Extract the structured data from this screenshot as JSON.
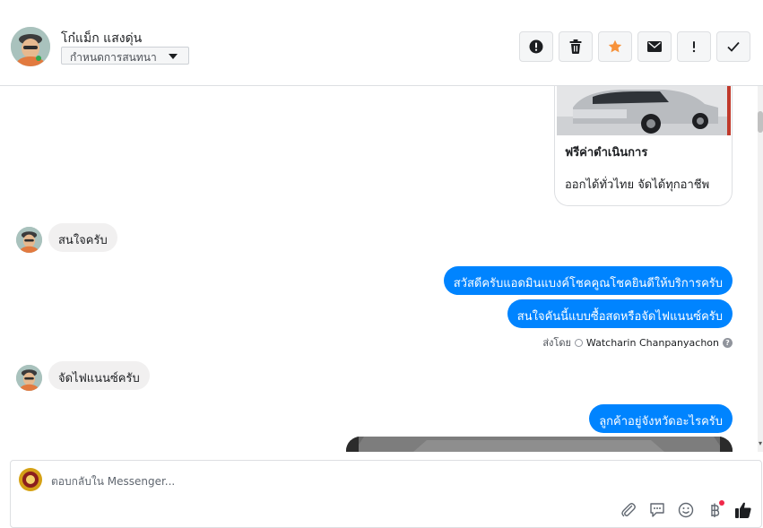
{
  "header": {
    "contact_name": "โก๋แม็ก แสงดุ่น",
    "label_dropdown": "กำหนดการสนทนา",
    "actions": [
      {
        "name": "spam-button",
        "icon": "alert-circle-icon"
      },
      {
        "name": "delete-button",
        "icon": "trash-icon"
      },
      {
        "name": "star-button",
        "icon": "star-icon"
      },
      {
        "name": "mark-unread-button",
        "icon": "envelope-icon"
      },
      {
        "name": "follow-up-button",
        "icon": "exclamation-icon"
      },
      {
        "name": "done-button",
        "icon": "check-icon"
      }
    ]
  },
  "card": {
    "title": "ฟรีค่าดำเนินการ",
    "subtitle": "ออกได้ทั่วไทย จัดได้ทุกอาชีพ"
  },
  "messages": [
    {
      "direction": "in",
      "text": "สนใจครับ"
    },
    {
      "direction": "out",
      "text": "สวัสดีครับแอดมินแบงค์โชคคูณโชคยินดีให้บริการครับ"
    },
    {
      "direction": "out",
      "text": "สนใจคันนี้แบบซื้อสดหรือจัดไฟแนนซ์ครับ"
    },
    {
      "direction": "in",
      "text": "จัดไฟแนนซ์ครับ"
    },
    {
      "direction": "out",
      "text": "ลูกค้าอยู่จังหวัดอะไรครับ"
    }
  ],
  "sent_by": {
    "prefix": "ส่งโดย",
    "name": "Watcharin Chanpanyachon"
  },
  "composer": {
    "placeholder": "ตอบกลับใน Messenger..."
  },
  "colors": {
    "accent": "#0084ff",
    "star": "#f7923b",
    "incoming_bubble": "#f1f0f0"
  }
}
